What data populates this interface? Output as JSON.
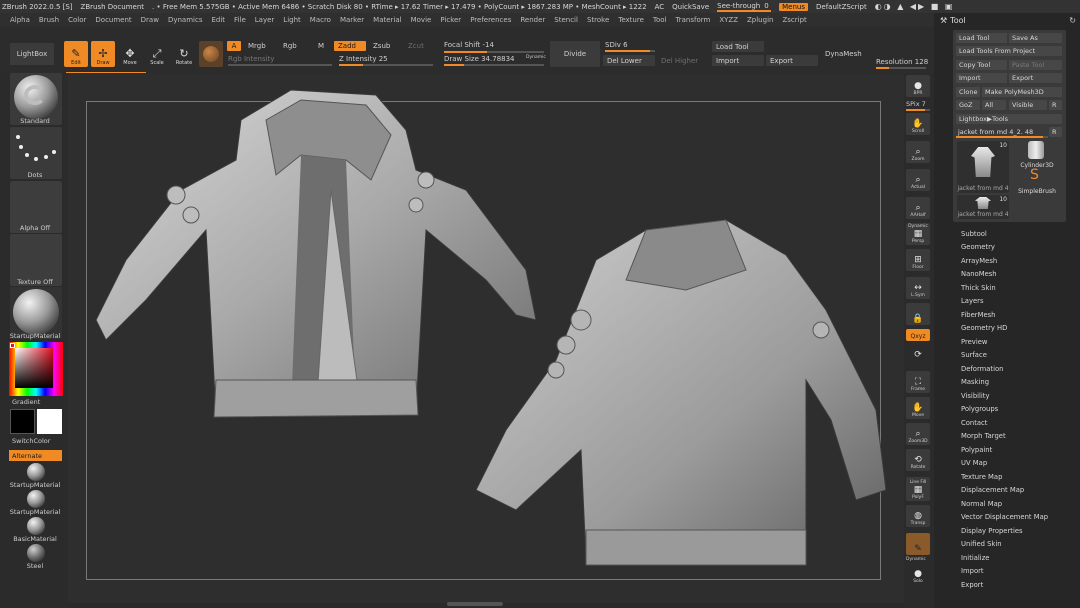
{
  "titlebar": {
    "app": "ZBrush 2022.0.5 [S]",
    "doc": "ZBrush Document",
    "stats": ". • Free Mem 5.575GB • Active Mem 6486 • Scratch Disk 80 • RTime ▸ 17.62 Timer ▸ 17.479 • PolyCount ▸ 1867.283 MP • MeshCount ▸ 1222",
    "ac": "AC",
    "quicksave": "QuickSave",
    "seethrough": "See-through",
    "seethrough_value": "0",
    "menus": "Menus",
    "zscript": "DefaultZScript"
  },
  "menubar": [
    "Alpha",
    "Brush",
    "Color",
    "Document",
    "Draw",
    "Dynamics",
    "Edit",
    "File",
    "Layer",
    "Light",
    "Macro",
    "Marker",
    "Material",
    "Movie",
    "Picker",
    "Preferences",
    "Render",
    "Stencil",
    "Stroke",
    "Texture",
    "Tool",
    "Transform",
    "XYZZ",
    "Zplugin",
    "Zscript"
  ],
  "toolbar": {
    "lightbox": "LightBox",
    "edit": "Edit",
    "draw": "Draw",
    "move": "Move",
    "scale": "Scale",
    "rotate": "Rotate",
    "a": "A",
    "mrgb": "Mrgb",
    "rgb": "Rgb",
    "m": "M",
    "zadd": "Zadd",
    "zsub": "Zsub",
    "zcut": "Zcut",
    "rgb_intensity": "Rgb Intensity",
    "z_intensity": "Z Intensity 25",
    "focal_shift": "Focal Shift -14",
    "draw_size": "Draw Size 34.78834",
    "dynamic": "Dynamic",
    "divide": "Divide",
    "sdiv": "SDiv 6",
    "del_lower": "Del Lower",
    "del_higher": "Del Higher",
    "load_tool": "Load Tool",
    "import": "Import",
    "export": "Export",
    "dynamesh": "DynaMesh",
    "resolution": "Resolution 128"
  },
  "leftshelf": {
    "standard": "Standard",
    "dots": "Dots",
    "alpha_off": "Alpha Off",
    "texture_off": "Texture Off",
    "startup_material": "StartupMaterial",
    "gradient": "Gradient",
    "switchcolor": "SwitchColor",
    "alternate": "Alternate",
    "materials": [
      "StartupMaterial",
      "StartupMaterial",
      "BasicMaterial",
      "Steel"
    ]
  },
  "rightshelf": {
    "bpr": "BPR",
    "spix": "SPix 7",
    "scroll": "Scroll",
    "zoom": "Zoom",
    "actual": "Actual",
    "aahalf": "AAHalf",
    "dynamic": "Dynamic",
    "persp": "Persp",
    "floor": "Floor",
    "lsym": "L.Sym",
    "lock": "",
    "xyz": "Qxyz",
    "frame": "Frame",
    "move": "Move",
    "zoom3d": "Zoom3D",
    "rotate": "Rotate",
    "linefill": "Line Fill",
    "polyf": "PolyF",
    "transp": "Transp",
    "dynamic2": "Dynamic",
    "solo": "Solo"
  },
  "toolpanel": {
    "title": "Tool",
    "load_tool": "Load Tool",
    "save_as": "Save As",
    "load_from_project": "Load Tools From Project",
    "copy_tool": "Copy Tool",
    "paste_tool": "Paste Tool",
    "import": "Import",
    "export": "Export",
    "clone": "Clone",
    "make_polymesh": "Make PolyMesh3D",
    "goz": "GoZ",
    "all": "All",
    "visible": "Visible",
    "r": "R",
    "lightbox_tools": "Lightbox▶Tools",
    "current_tool": "jacket from md 4_2. 48",
    "thumbs": [
      {
        "name": "jacket from md 4",
        "count": "10"
      },
      {
        "name": "Cylinder3D",
        "count": ""
      },
      {
        "name": "SimpleBrush",
        "count": ""
      },
      {
        "name": "jacket from md 4",
        "count": "10"
      }
    ],
    "subpalettes": [
      "Subtool",
      "Geometry",
      "ArrayMesh",
      "NanoMesh",
      "Thick Skin",
      "Layers",
      "FiberMesh",
      "Geometry HD",
      "Preview",
      "Surface",
      "Deformation",
      "Masking",
      "Visibility",
      "Polygroups",
      "Contact",
      "Morph Target",
      "Polypaint",
      "UV Map",
      "Texture Map",
      "Displacement Map",
      "Normal Map",
      "Vector Displacement Map",
      "Display Properties",
      "Unified Skin",
      "Initialize",
      "Import",
      "Export"
    ]
  },
  "colors": {
    "accent": "#f08a24",
    "bg": "#2a2a2a",
    "panel": "#3a3a3a"
  }
}
